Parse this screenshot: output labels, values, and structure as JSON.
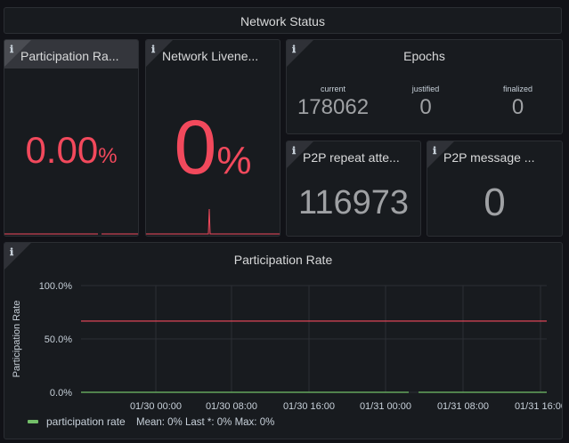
{
  "header": {
    "title": "Network Status"
  },
  "info_icon": "ℹ",
  "participation_stat": {
    "title": "Participation Ra...",
    "value": "0.00",
    "unit": "%",
    "color": "#f2495c"
  },
  "liveness_stat": {
    "title": "Network Livene...",
    "value": "0",
    "unit": "%",
    "color": "#f2495c"
  },
  "epochs": {
    "title": "Epochs",
    "columns": [
      {
        "label": "current",
        "value": "178062"
      },
      {
        "label": "justified",
        "value": "0"
      },
      {
        "label": "finalized",
        "value": "0"
      }
    ]
  },
  "p2p_repeat": {
    "title": "P2P repeat atte...",
    "value": "116973"
  },
  "p2p_message": {
    "title": "P2P message ...",
    "value": "0"
  },
  "chart_panel": {
    "title": "Participation Rate"
  },
  "colors": {
    "threshold": "#f2495c",
    "series": "#73bf69",
    "grid": "#2c2f34",
    "panel_bg": "#181b1f",
    "page_bg": "#111217"
  },
  "chart_data": {
    "type": "line",
    "ylabel": "Participation Rate",
    "ylim": [
      0,
      100
    ],
    "y_ticks": [
      "100.0%",
      "50.0%",
      "0.0%"
    ],
    "x_ticks": [
      "01/30 00:00",
      "01/30 08:00",
      "01/30 16:00",
      "01/31 00:00",
      "01/31 08:00",
      "01/31 16:00"
    ],
    "threshold": 66.7,
    "series": [
      {
        "name": "participation rate",
        "values": [
          0,
          0,
          0,
          0,
          0,
          0
        ]
      }
    ],
    "legend": {
      "name": "participation rate",
      "stats": "Mean: 0%   Last *: 0%   Max: 0%",
      "placement": "bottom-left"
    }
  }
}
